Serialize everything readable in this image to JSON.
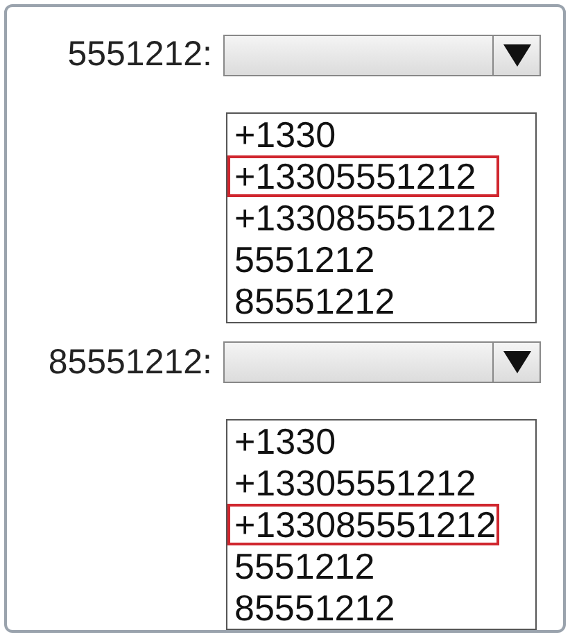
{
  "dropdowns": [
    {
      "label": "5551212:",
      "options": [
        {
          "text": "+1330",
          "selected": false
        },
        {
          "text": "+13305551212",
          "selected": true
        },
        {
          "text": "+133085551212",
          "selected": false
        },
        {
          "text": "5551212",
          "selected": false
        },
        {
          "text": "85551212",
          "selected": false
        }
      ]
    },
    {
      "label": "85551212:",
      "options": [
        {
          "text": "+1330",
          "selected": false
        },
        {
          "text": "+13305551212",
          "selected": false
        },
        {
          "text": "+133085551212",
          "selected": true
        },
        {
          "text": "5551212",
          "selected": false
        },
        {
          "text": "85551212",
          "selected": false
        }
      ]
    }
  ]
}
